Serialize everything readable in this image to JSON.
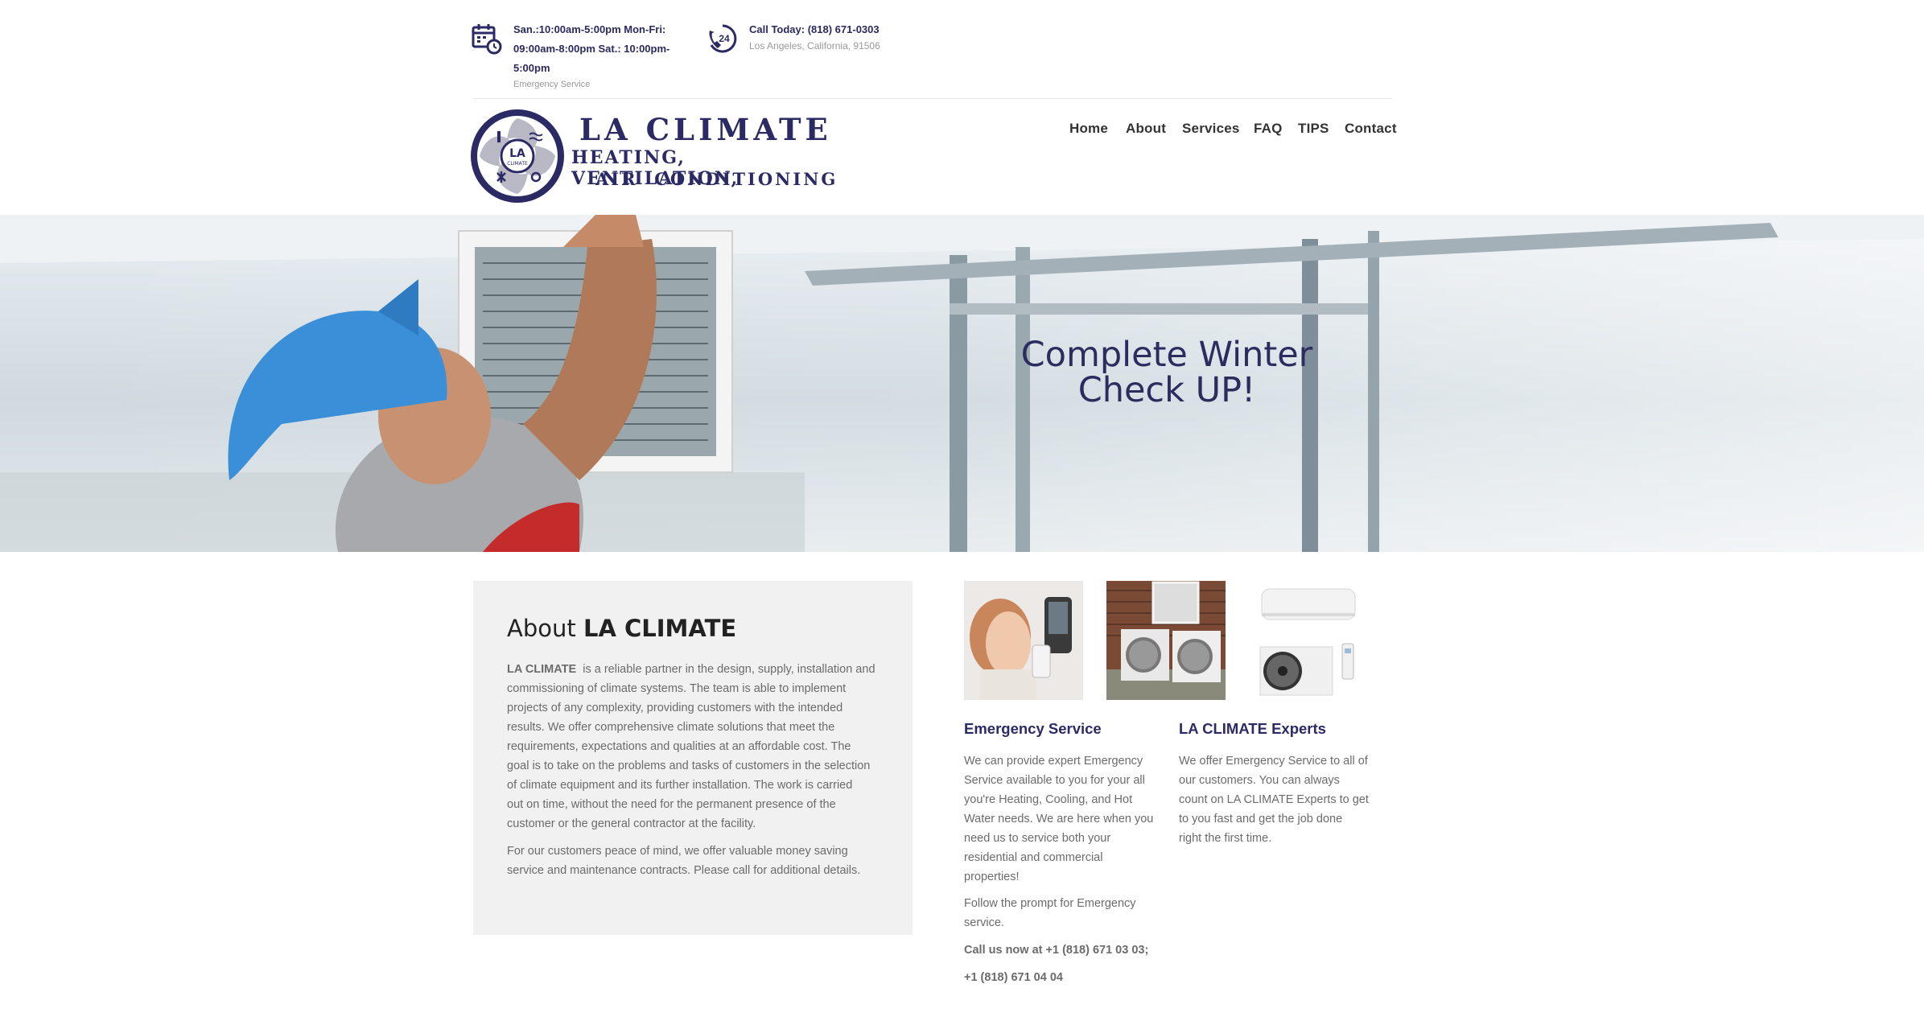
{
  "topbar": {
    "hours_line1": "San.:10:00am-5:00pm Mon-Fri:",
    "hours_line2": "09:00am-8:00pm Sat.: 10:00pm-",
    "hours_line3": "5:00pm",
    "hours_sub": "Emergency Service",
    "phone_label": "Call Today: (818) 671-0303",
    "phone_sub": "Los Angeles, California, 91506",
    "badge_24": "24"
  },
  "logo": {
    "line1": "LA CLIMATE",
    "line2": "HEATING, VENTILATION,",
    "line3": "AIR  CONDITIONING",
    "emblem_big": "LA",
    "emblem_small": "CLIMATE"
  },
  "nav": {
    "items": [
      "Home",
      "About",
      "Services",
      "FAQ",
      "TIPS",
      "Contact"
    ]
  },
  "hero": {
    "title_line1": "Complete Winter",
    "title_line2": "Check UP!"
  },
  "about": {
    "title_light": "About",
    "title_bold": "LA CLIMATE",
    "p1_strong": "LA CLIMATE",
    "p1_lines": [
      "  is a reliable partner in the design, supply, installation and",
      "commissioning of climate systems. The team is able to implement",
      "projects of any complexity, providing customers with the intended",
      "results. We offer comprehensive climate solutions that meet the",
      "requirements, expectations and qualities at an affordable cost. The",
      "goal is to take on the problems and tasks of customers in the selection",
      "of climate equipment and its further installation. The work is carried",
      "out on time, without the need for the permanent presence of the",
      "customer or the general contractor at the facility."
    ],
    "p2_lines": [
      "For our customers peace of mind, we offer valuable money saving",
      "service and maintenance contracts. Please call for additional details."
    ]
  },
  "services": {
    "emergency": {
      "title": "Emergency Service",
      "lines": [
        "We can provide expert Emergency",
        "Service available to you for your all",
        "you're Heating, Cooling, and Hot",
        "Water needs. We are here when you",
        "need us to service both your",
        "residential and commercial",
        "properties!"
      ],
      "follow_lines": [
        "Follow the prompt for Emergency",
        "service."
      ],
      "call1": "Call us now at +1 (818) 671 03 03;",
      "call2": "+1 (818) 671 04 04"
    },
    "experts": {
      "title": "LA CLIMATE Experts",
      "lines": [
        "We offer Emergency Service to all of",
        "our customers. You can always",
        "count on LA CLIMATE Experts to get",
        "to you fast and get the job done",
        "right the first time."
      ]
    }
  },
  "colors": {
    "brand": "#2b2a65",
    "nav_text": "#333333",
    "about_bg": "#f1f1f1",
    "body_text": "#6b6b6b"
  },
  "icons": [
    "calendar-clock-icon",
    "phone-24-icon"
  ]
}
